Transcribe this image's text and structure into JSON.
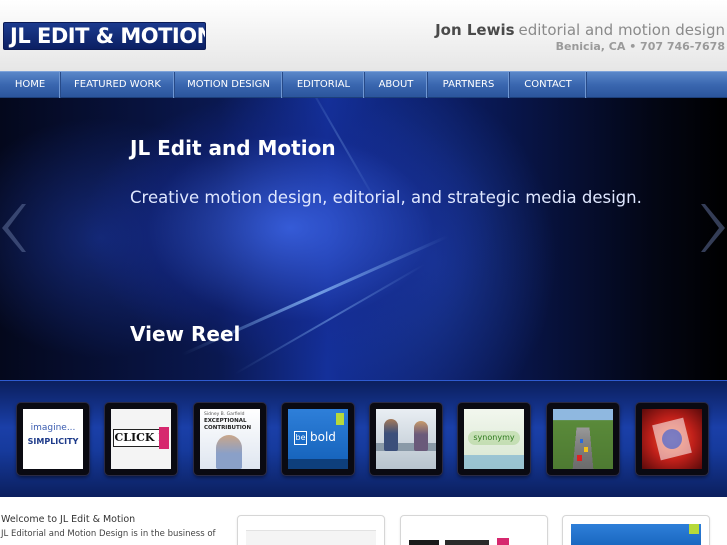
{
  "header": {
    "logo_text": "JL EDIT & MOTION",
    "name": "Jon Lewis",
    "role": "editorial and motion design",
    "location": "Benicia, CA • 707 746-7678"
  },
  "nav": {
    "items": [
      {
        "label": "HOME"
      },
      {
        "label": "FEATURED WORK"
      },
      {
        "label": "MOTION DESIGN"
      },
      {
        "label": "EDITORIAL"
      },
      {
        "label": "ABOUT"
      },
      {
        "label": "PARTNERS"
      },
      {
        "label": "CONTACT"
      }
    ]
  },
  "hero": {
    "title": "JL Edit and Motion",
    "subtitle": "Creative motion design, editorial, and strategic media design.",
    "reel_link": "View Reel",
    "prev_icon": "chevron-left-icon",
    "next_icon": "chevron-right-icon"
  },
  "thumbnails": [
    {
      "line1": "imagine...",
      "line2": "SIMPLICITY"
    },
    {
      "text": "CLICK R"
    },
    {
      "line1": "Sidney B. Garfield",
      "line2": "EXCEPTIONAL",
      "line3": "CONTRIBUTION"
    },
    {
      "line1": "be",
      "line2": "bold"
    },
    {
      "text": ""
    },
    {
      "text": "synonymy"
    },
    {
      "text": ""
    },
    {
      "text": ""
    }
  ],
  "welcome": {
    "heading": "Welcome to JL Edit & Motion",
    "text": "JL Editorial and Motion Design is in the business of"
  },
  "colors": {
    "brand_navy": "#0b1f63",
    "nav_blue": "#3a67b0",
    "hero_blue": "#14309a"
  }
}
